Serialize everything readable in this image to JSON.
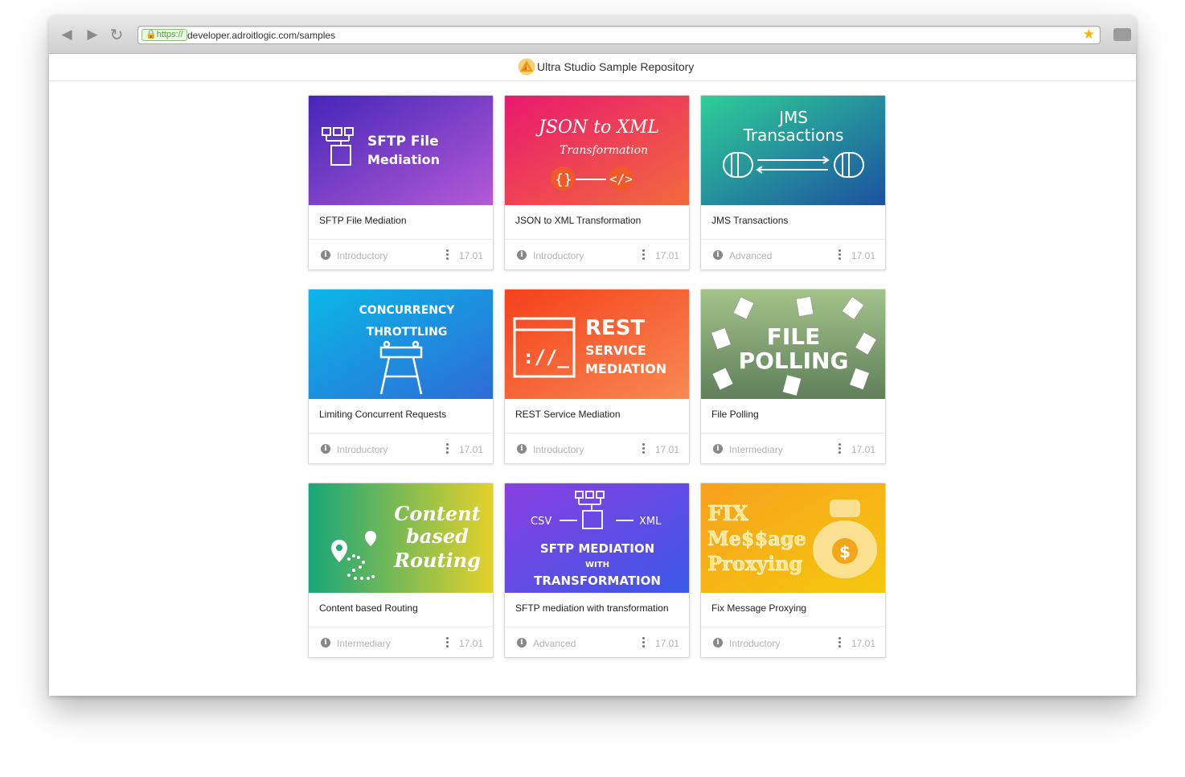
{
  "browser": {
    "https_label": "https://",
    "url": "developer.adroitlogic.com/samples"
  },
  "header": {
    "title": "Ultra Studio Sample Repository"
  },
  "cards": [
    {
      "title": "SFTP File Mediation",
      "level": "Introductory",
      "version": "17.01",
      "banner_lines": [
        "SFTP File",
        "Mediation"
      ]
    },
    {
      "title": "JSON to XML Transformation",
      "level": "Introductory",
      "version": "17.01",
      "banner_lines": [
        "JSON to XML",
        "Transformation"
      ]
    },
    {
      "title": "JMS Transactions",
      "level": "Advanced",
      "version": "17.01",
      "banner_lines": [
        "JMS",
        "Transactions"
      ]
    },
    {
      "title": "Limiting Concurrent Requests",
      "level": "Introductory",
      "version": "17.01",
      "banner_lines": [
        "CONCURRENCY",
        "THROTTLING"
      ]
    },
    {
      "title": "REST Service Mediation",
      "level": "Introductory",
      "version": "17.01",
      "banner_lines": [
        "REST",
        "SERVICE",
        "MEDIATION"
      ]
    },
    {
      "title": "File Polling",
      "level": "Intermediary",
      "version": "17.01",
      "banner_lines": [
        "FILE",
        "POLLING"
      ]
    },
    {
      "title": "Content based Routing",
      "level": "Intermediary",
      "version": "17.01",
      "banner_lines": [
        "Content",
        "based",
        "Routing"
      ]
    },
    {
      "title": "SFTP mediation with transformation",
      "level": "Advanced",
      "version": "17.01",
      "banner_lines": [
        "CSV",
        "XML",
        "SFTP MEDIATION",
        "WITH",
        "TRANSFORMATION"
      ]
    },
    {
      "title": "Fix Message Proxying",
      "level": "Introductory",
      "version": "17.01",
      "banner_lines": [
        "FIX",
        "Me$$age",
        "Proxying"
      ]
    }
  ]
}
